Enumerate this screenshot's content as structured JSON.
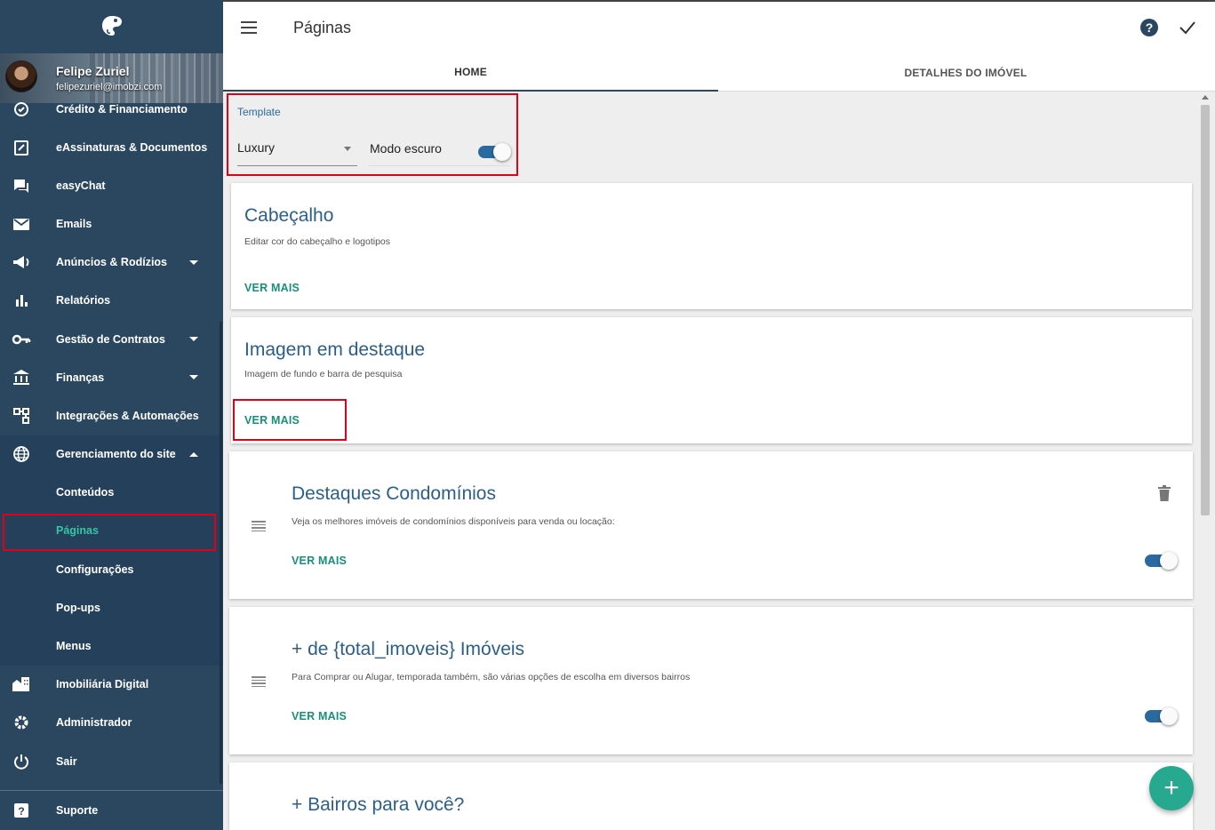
{
  "user": {
    "name": "Felipe Zuriel",
    "email": "felipezuriel@imobzi.com"
  },
  "nav": {
    "items": [
      {
        "label": "Crédito & Financiamento",
        "icon": "credit-icon"
      },
      {
        "label": "eAssinaturas & Documentos",
        "icon": "signature-icon"
      },
      {
        "label": "easyChat",
        "icon": "chat-icon"
      },
      {
        "label": "Emails",
        "icon": "email-icon"
      },
      {
        "label": "Anúncios & Rodízios",
        "icon": "megaphone-icon"
      },
      {
        "label": "Relatórios",
        "icon": "bar-chart-icon"
      },
      {
        "label": "Gestão de Contratos",
        "icon": "key-icon"
      },
      {
        "label": "Finanças",
        "icon": "bank-icon"
      },
      {
        "label": "Integrações & Automações",
        "icon": "integration-icon"
      },
      {
        "label": "Gerenciamento do site",
        "icon": "globe-icon"
      }
    ],
    "sub_items": [
      {
        "label": "Conteúdos"
      },
      {
        "label": "Páginas",
        "active": true
      },
      {
        "label": "Configurações"
      },
      {
        "label": "Pop-ups"
      },
      {
        "label": "Menus"
      }
    ],
    "bottom_items": [
      {
        "label": "Imobiliária Digital",
        "icon": "building-icon"
      },
      {
        "label": "Administrador",
        "icon": "gear-icon"
      },
      {
        "label": "Sair",
        "icon": "power-icon"
      }
    ],
    "support": {
      "label": "Suporte",
      "icon": "help-icon"
    }
  },
  "header": {
    "title": "Páginas"
  },
  "tabs": [
    {
      "label": "HOME",
      "active": true
    },
    {
      "label": "DETALHES DO IMÓVEL",
      "active": false
    }
  ],
  "template": {
    "label": "Template",
    "selected": "Luxury",
    "dark_mode_label": "Modo escuro",
    "dark_mode_on": true
  },
  "cards": [
    {
      "title": "Cabeçalho",
      "desc": "Editar cor do cabeçalho e logotipos",
      "action": "VER MAIS"
    },
    {
      "title": "Imagem em destaque",
      "desc": "Imagem de fundo e barra de pesquisa",
      "action": "VER MAIS"
    },
    {
      "title": "Destaques Condomínios",
      "desc": "Veja os melhores imóveis de condomínios disponíveis para venda ou locação:",
      "action": "VER MAIS",
      "enabled": true
    },
    {
      "title": "+ de {total_imoveis} Imóveis",
      "desc": "Para Comprar ou Alugar, temporada também, são várias opções de escolha em diversos bairros",
      "action": "VER MAIS",
      "enabled": true
    },
    {
      "title": "+ Bairros para você?",
      "desc": ""
    }
  ],
  "fab": {
    "label": "+"
  },
  "colors": {
    "sidebar": "#2b4760",
    "accent": "#17907a",
    "title": "#2b5f8a",
    "highlight": "#e0001a"
  }
}
